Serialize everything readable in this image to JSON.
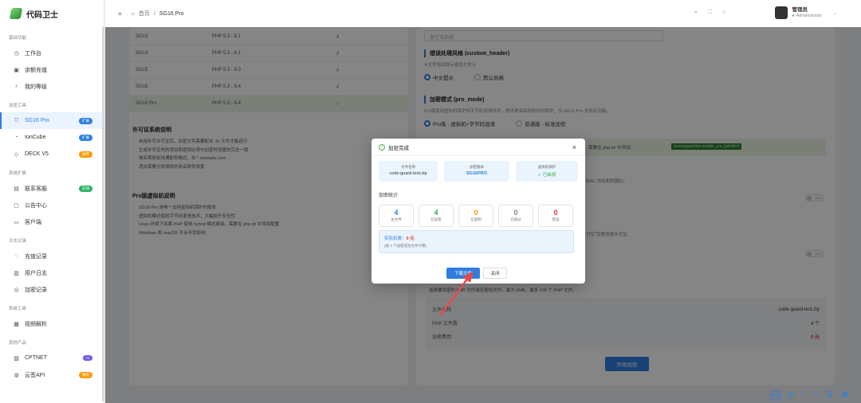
{
  "app": {
    "name": "代码卫士"
  },
  "sidebar": {
    "groups": [
      {
        "title": "基础功能",
        "items": [
          {
            "label": "工作台",
            "icon": "◷"
          },
          {
            "label": "余额充值",
            "icon": "▣"
          },
          {
            "label": "我的等级",
            "icon": "♁"
          }
        ]
      },
      {
        "title": "加密工具",
        "items": [
          {
            "label": "SG16 Pro",
            "icon": "⛉",
            "badge": "扩展",
            "active": true
          },
          {
            "label": "IonCube",
            "icon": "◔",
            "badge": "扩展"
          },
          {
            "label": "DECK V5",
            "icon": "◇",
            "badge": "推荐"
          }
        ]
      },
      {
        "title": "系统扩展",
        "items": [
          {
            "label": "联系客服",
            "icon": "▤",
            "badge": "在线"
          },
          {
            "label": "公告中心",
            "icon": "▢"
          },
          {
            "label": "客户端",
            "icon": "▭"
          }
        ]
      },
      {
        "title": "日志记录",
        "items": [
          {
            "label": "充值记录",
            "icon": "◌"
          },
          {
            "label": "用户日志",
            "icon": "▥"
          },
          {
            "label": "加密记录",
            "icon": "◎"
          }
        ]
      },
      {
        "title": "系统工具",
        "items": [
          {
            "label": "视频解析",
            "icon": "▦"
          }
        ]
      },
      {
        "title": "其他产品",
        "items": [
          {
            "label": "CPTNET",
            "icon": "▧",
            "badge": "AI"
          },
          {
            "label": "云签API",
            "icon": "◍",
            "badge": "推荐"
          }
        ]
      }
    ],
    "badge_colors": {
      "扩展": "#2f7de1",
      "推荐": "#ff9900",
      "在线": "#28b463",
      "AI": "#6c5ce7"
    }
  },
  "topbar": {
    "home": "首页",
    "current": "SG16 Pro",
    "user": {
      "name": "管理员",
      "role": "Administrator"
    }
  },
  "table": {
    "rows": [
      {
        "name": "SG13",
        "php": "PHP 5.3 - 8.1",
        "mark": "✗"
      },
      {
        "name": "SG14",
        "php": "PHP 5.3 - 8.1",
        "mark": "✗"
      },
      {
        "name": "SG15",
        "php": "PHP 5.3 - 8.3",
        "mark": "✗"
      },
      {
        "name": "SG16",
        "php": "PHP 5.3 - 8.4",
        "mark": "✗"
      },
      {
        "name": "SG16 Pro",
        "php": "PHP 5.3 - 8.4",
        "mark": "✓"
      }
    ]
  },
  "license": {
    "title": "许可证系统说明",
    "lines": [
      "启用许可许可证后，加密文件需要配合 .lic 文件才能运行",
      "生成许可证时的项目和密钥必须与加密时设置的完全一致",
      "域名限制支持通配符格式，如 *.example.com",
      "适合需要分发授权的商业软件场景"
    ]
  },
  "vm": {
    "title": "Pro版虚拟机说明",
    "lines": [
      "SG16 Pro 是唯一支持虚拟机保护的版本",
      "虚拟机模式使用字节码混淆技术，大幅提升安全性",
      "Linux 环境下如果 PHP 使用 hybrid 模式编译，需要在 php.ini 中添加配置",
      "Windows 和 macOS 平台不受影响"
    ]
  },
  "right": {
    "top_placeholder": "留空无前缀",
    "custom_header": {
      "title": "错误处理风格 (custom_header)",
      "note": "※文件错误提示或官方提示",
      "options": [
        "中文提示",
        "默认风格"
      ]
    },
    "pro_mode": {
      "title": "加密模式 (pro_mode)",
      "note": "Pro版使用虚拟机保护和字节码混淆技术，提供更高级别的代码保护，仅 SG16 Pro 支持此功能。",
      "options": [
        "Pro版 - 虚拟机+字节码混淆",
        "普通版 - 标准加密"
      ]
    },
    "green_note": "需要在 php.ini 中添加：",
    "green_code": "sourceguardian.enable_vm_hybrid=1",
    "hint1": "MAC 地址和机器ID。",
    "hint2": "可空\"完整创建许可证。",
    "switch_label": "OFF",
    "upload_note": "选择要加密的 PHP 文件或压缩包文件，最大 5MB，最多 100 个 PHP 文件。",
    "summary": [
      {
        "k": "文件名称",
        "v": "code-guard-test.zip"
      },
      {
        "k": "PHP 文件数",
        "v": "4 个"
      },
      {
        "k": "加密费用",
        "v": "0 元"
      }
    ],
    "start_button": "开始加密"
  },
  "modal": {
    "title": "加密完成",
    "info": [
      {
        "k": "文件名称",
        "v": "code-guard-test.zip"
      },
      {
        "k": "加密版本",
        "v": "SG16PRO"
      },
      {
        "k": "虚拟机保护",
        "v": "✓ 已启用"
      }
    ],
    "stats_title": "加密统计",
    "stats": [
      {
        "n": "4",
        "l": "总文件",
        "c": "#2f7de1"
      },
      {
        "n": "4",
        "l": "已加密",
        "c": "#28a745"
      },
      {
        "n": "0",
        "l": "已复制",
        "c": "#ff9900"
      },
      {
        "n": "0",
        "l": "已跳过",
        "c": "#888888"
      },
      {
        "n": "0",
        "l": "错误",
        "c": "#e53935"
      }
    ],
    "cost_label": "实际扣费：",
    "cost_value": "0 元",
    "cost_note": "(按 4 个加密成功文件计算)",
    "download": "下载文件",
    "close": "关闭"
  },
  "float_tools": {
    "tag": "IPV6",
    "items": [
      "中",
      "°,",
      "⌖",
      "🎙",
      "▦"
    ]
  }
}
